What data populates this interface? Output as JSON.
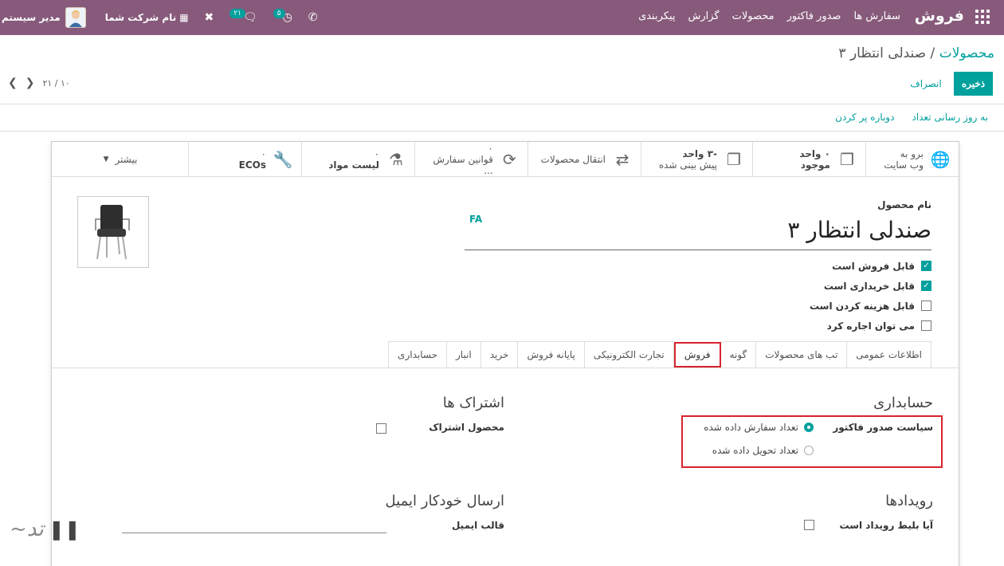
{
  "navbar": {
    "brand": "فروش",
    "menu": [
      "سفارش ها",
      "صدور فاکتور",
      "محصولات",
      "گزارش",
      "پیکربندی"
    ],
    "user": "مدیر سیستم",
    "company": "نام شرکت شما",
    "messages_count": "۲۱",
    "activities_count": "۵"
  },
  "breadcrumb": {
    "parent": "محصولات",
    "sep": " / ",
    "current": "صندلی انتظار ۳"
  },
  "buttons": {
    "save": "ذخیره",
    "discard": "انصراف"
  },
  "pager": {
    "value": "۲۱ / ۱۰"
  },
  "status_actions": [
    "به روز رسانی تعداد",
    "دوباره پر کردن"
  ],
  "smart_buttons": [
    {
      "line1": "برو به",
      "line2": "وب سایت",
      "icon": "globe-icon"
    },
    {
      "line1": "۰ واحد",
      "line2": "موجود",
      "icon": "cubes-icon"
    },
    {
      "line1": "-۳ واحد",
      "line2": "پیش بینی شده",
      "icon": "cubes-icon"
    },
    {
      "line1": "",
      "line2": "انتقال محصولات",
      "icon": "exchange-icon"
    },
    {
      "line1": "۰",
      "line2": "قوانین سفارش ...",
      "icon": "refresh-icon"
    },
    {
      "line1": "۰",
      "line2": "لیست مواد",
      "icon": "flask-icon"
    },
    {
      "line1": "۰",
      "line2": "ECOs",
      "icon": "wrench-icon"
    },
    {
      "line1": "",
      "line2": "بیشتر",
      "icon": "caret-down-icon"
    }
  ],
  "product": {
    "name_label": "نام محصول",
    "name": "صندلی انتظار ۳",
    "lang": "FA",
    "checks": [
      {
        "label": "قابل فروش است",
        "checked": true
      },
      {
        "label": "قابل خریداری است",
        "checked": true
      },
      {
        "label": "قابل هزینه کردن است",
        "checked": false
      },
      {
        "label": "می توان اجاره کرد",
        "checked": false
      }
    ]
  },
  "tabs": [
    "اطلاعات عمومی",
    "تب های محصولات",
    "گونه",
    "فروش",
    "تجارت الکترونیکی",
    "پایانه فروش",
    "خرید",
    "انبار",
    "حسابداری"
  ],
  "active_tab": "فروش",
  "sales": {
    "accounting_title": "حسابداری",
    "invoice_policy_label": "سیاست صدور فاکتور",
    "policy_options": [
      {
        "label": "تعداد سفارش داده شده",
        "selected": true
      },
      {
        "label": "تعداد تحویل داده شده",
        "selected": false
      }
    ],
    "subscriptions_title": "اشتراک ها",
    "subscription_product_label": "محصول اشتراک",
    "events_title": "رویدادها",
    "event_ticket_label": "آیا بلیط رویداد است",
    "auto_email_title": "ارسال خودکار ایمیل",
    "email_template_label": "قالب ایمیل"
  },
  "colors": {
    "navbar": "#875a7b",
    "accent": "#00a09d",
    "highlight": "#d9232e"
  }
}
